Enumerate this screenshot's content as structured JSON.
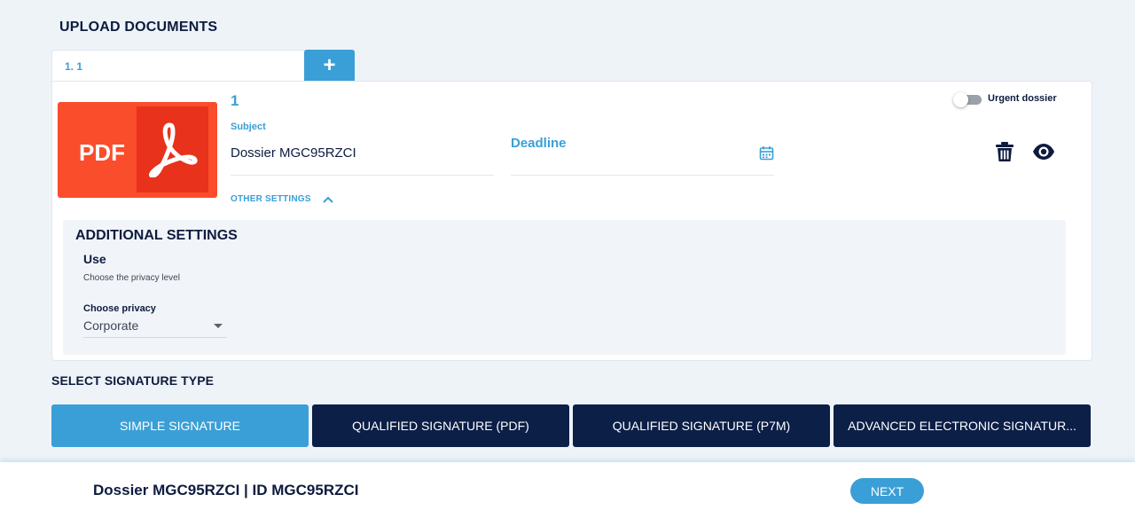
{
  "page": {
    "heading": "UPLOAD DOCUMENTS"
  },
  "tabs": {
    "active_tab_label": "1. 1",
    "add_button_label": "+"
  },
  "document": {
    "number": "1",
    "thumbnail_label": "PDF",
    "subject_label": "Subject",
    "subject_value": "Dossier MGC95RZCI",
    "deadline_label": "Deadline",
    "urgent_label": "Urgent dossier",
    "urgent_enabled": false,
    "other_settings_label": "OTHER SETTINGS"
  },
  "additional_settings": {
    "title": "ADDITIONAL SETTINGS",
    "use_title": "Use",
    "use_description": "Choose the privacy level",
    "privacy_label": "Choose privacy",
    "privacy_value": "Corporate"
  },
  "signature": {
    "heading": "SELECT SIGNATURE TYPE",
    "options": [
      {
        "label": "SIMPLE SIGNATURE",
        "selected": true
      },
      {
        "label": "QUALIFIED SIGNATURE (PDF)",
        "selected": false
      },
      {
        "label": "QUALIFIED SIGNATURE (P7M)",
        "selected": false
      },
      {
        "label": "ADVANCED ELECTRONIC SIGNATUR...",
        "selected": false
      }
    ]
  },
  "footer": {
    "title": "Dossier MGC95RZCI | ID MGC95RZCI",
    "next_label": "NEXT"
  },
  "colors": {
    "accent": "#3a9fd6",
    "dark_navy": "#0b1f47",
    "pdf_red": "#fa4d2c",
    "background": "#eef3f8"
  },
  "icons": {
    "calendar": "calendar-icon",
    "trash": "trash-icon",
    "eye": "eye-icon",
    "chevron": "chevron-up-icon",
    "pdf": "adobe-pdf-icon"
  }
}
